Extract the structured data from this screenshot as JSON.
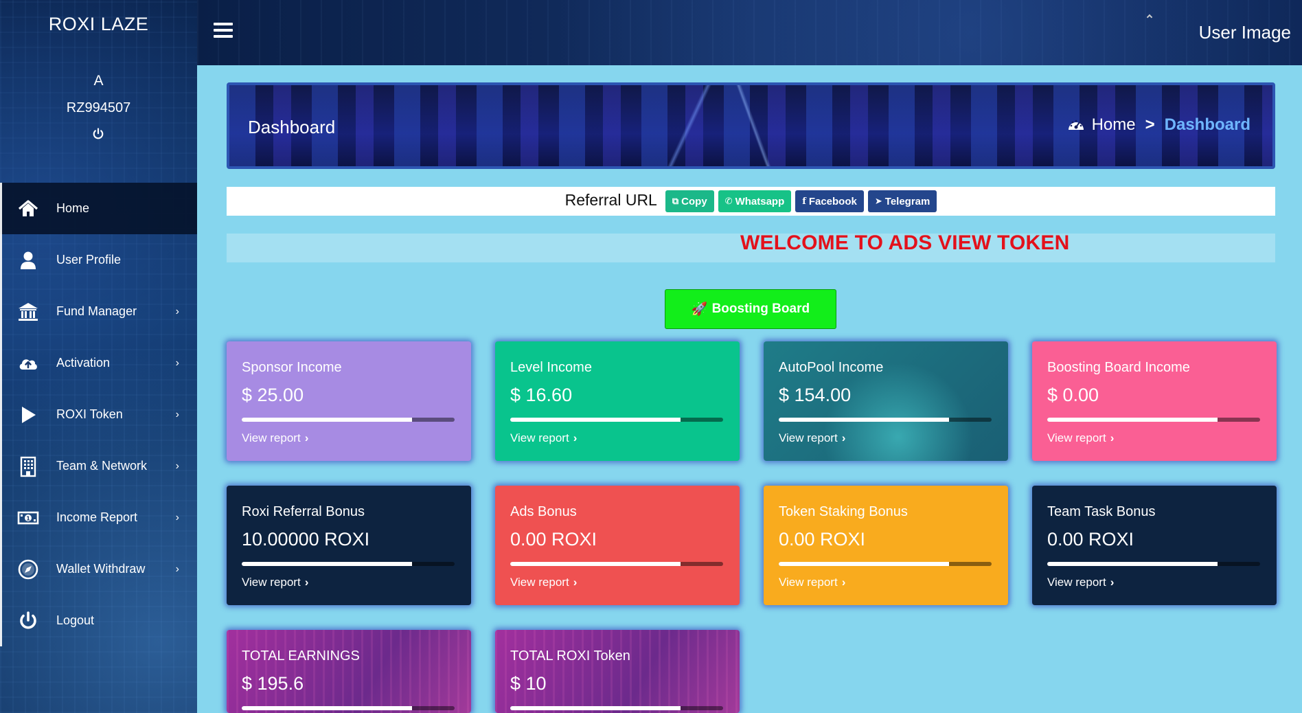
{
  "sidebar": {
    "brand": "ROXI LAZE",
    "user_initial": "A",
    "user_id": "RZ994507",
    "items": [
      {
        "label": "Home",
        "icon": "home-icon",
        "has_submenu": false,
        "active": true
      },
      {
        "label": "User Profile",
        "icon": "user-icon",
        "has_submenu": false,
        "active": false
      },
      {
        "label": "Fund Manager",
        "icon": "bank-icon",
        "has_submenu": true,
        "active": false
      },
      {
        "label": "Activation",
        "icon": "cloud-upload-icon",
        "has_submenu": true,
        "active": false
      },
      {
        "label": "ROXI Token",
        "icon": "play-icon",
        "has_submenu": true,
        "active": false
      },
      {
        "label": "Team & Network",
        "icon": "building-icon",
        "has_submenu": true,
        "active": false
      },
      {
        "label": "Income Report",
        "icon": "money-icon",
        "has_submenu": true,
        "active": false
      },
      {
        "label": "Wallet Withdraw",
        "icon": "compass-icon",
        "has_submenu": true,
        "active": false
      },
      {
        "label": "Logout",
        "icon": "power-icon",
        "has_submenu": false,
        "active": false
      }
    ]
  },
  "topbar": {
    "user_image_alt": "User Image"
  },
  "banner": {
    "title": "Dashboard",
    "breadcrumb_home": "Home",
    "breadcrumb_separator": ">",
    "breadcrumb_current": "Dashboard"
  },
  "referral": {
    "label": "Referral URL",
    "buttons": [
      {
        "label": "Copy",
        "color": "#1bb889"
      },
      {
        "label": "Whatsapp",
        "color": "#17c287"
      },
      {
        "label": "Facebook",
        "color": "#24468c"
      },
      {
        "label": "Telegram",
        "color": "#24468c"
      }
    ]
  },
  "welcome": "WELCOME TO ADS VIEW TOKEN",
  "boost_button": "Boosting Board",
  "view_report_label": "View report",
  "cards": [
    {
      "title": "Sponsor Income",
      "value": "$ 25.00",
      "progress": 0.8,
      "color": "#a78be3"
    },
    {
      "title": "Level Income",
      "value": "$ 16.60",
      "progress": 0.8,
      "color": "#09c48d"
    },
    {
      "title": "AutoPool Income",
      "value": "$ 154.00",
      "progress": 0.8,
      "color": "#1f7c88"
    },
    {
      "title": "Boosting Board Income",
      "value": "$ 0.00",
      "progress": 0.8,
      "color": "#fa5f94"
    },
    {
      "title": "Roxi Referral Bonus",
      "value": "10.00000 ROXI",
      "progress": 0.8,
      "color": "#0d2340"
    },
    {
      "title": "Ads Bonus",
      "value": "0.00 ROXI",
      "progress": 0.8,
      "color": "#ef5151"
    },
    {
      "title": "Token Staking Bonus",
      "value": "0.00 ROXI",
      "progress": 0.8,
      "color": "#f9ab1e"
    },
    {
      "title": "Team Task Bonus",
      "value": "0.00 ROXI",
      "progress": 0.8,
      "color": "#0d2340"
    },
    {
      "title": "TOTAL EARNINGS",
      "value": "$ 195.6",
      "progress": 0.8,
      "color": "#8a2a9c"
    },
    {
      "title": "TOTAL ROXI Token",
      "value": "$ 10",
      "progress": 0.8,
      "color": "#8a2a9c"
    }
  ]
}
